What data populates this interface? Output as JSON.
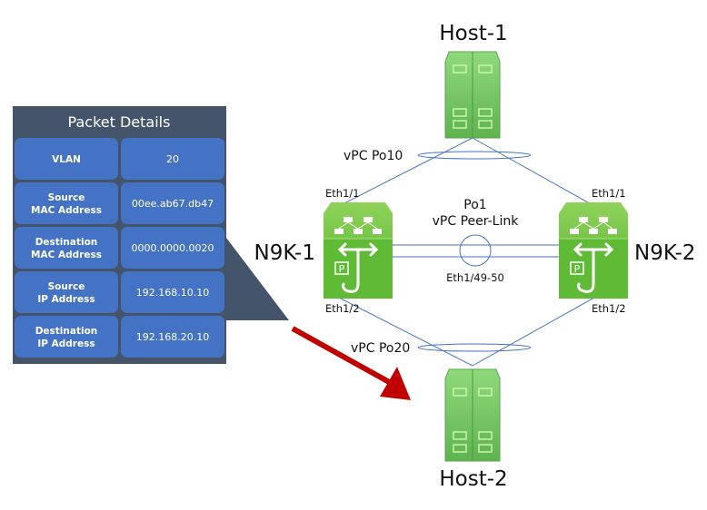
{
  "packet_details": {
    "title": "Packet Details",
    "rows": [
      {
        "field": [
          "VLAN"
        ],
        "value": "20"
      },
      {
        "field": [
          "Source",
          "MAC Address"
        ],
        "value": "00ee.ab67.db47"
      },
      {
        "field": [
          "Destination",
          "MAC Address"
        ],
        "value": "0000.0000.0020"
      },
      {
        "field": [
          "Source",
          "IP Address"
        ],
        "value": "192.168.10.10"
      },
      {
        "field": [
          "Destination",
          "IP Address"
        ],
        "value": "192.168.20.10"
      }
    ]
  },
  "nodes": {
    "host1": {
      "label": "Host-1"
    },
    "host2": {
      "label": "Host-2"
    },
    "switch1": {
      "label": "N9K-1",
      "uplink_port": "Eth1/1",
      "downlink_port": "Eth1/2"
    },
    "switch2": {
      "label": "N9K-2",
      "uplink_port": "Eth1/1",
      "downlink_port": "Eth1/2"
    }
  },
  "links": {
    "vpc_po10": "vPC Po10",
    "vpc_po20": "vPC Po20",
    "peer_link": {
      "name": "Po1",
      "description": "vPC Peer-Link",
      "ports": "Eth1/49-50"
    }
  },
  "colors": {
    "panel_bg": "#44546a",
    "cell_bg": "#4472c4",
    "link": "#4472c4",
    "arrow": "#c00000",
    "device_green": "#6cc24a",
    "host_green": "#7ccd6e"
  }
}
